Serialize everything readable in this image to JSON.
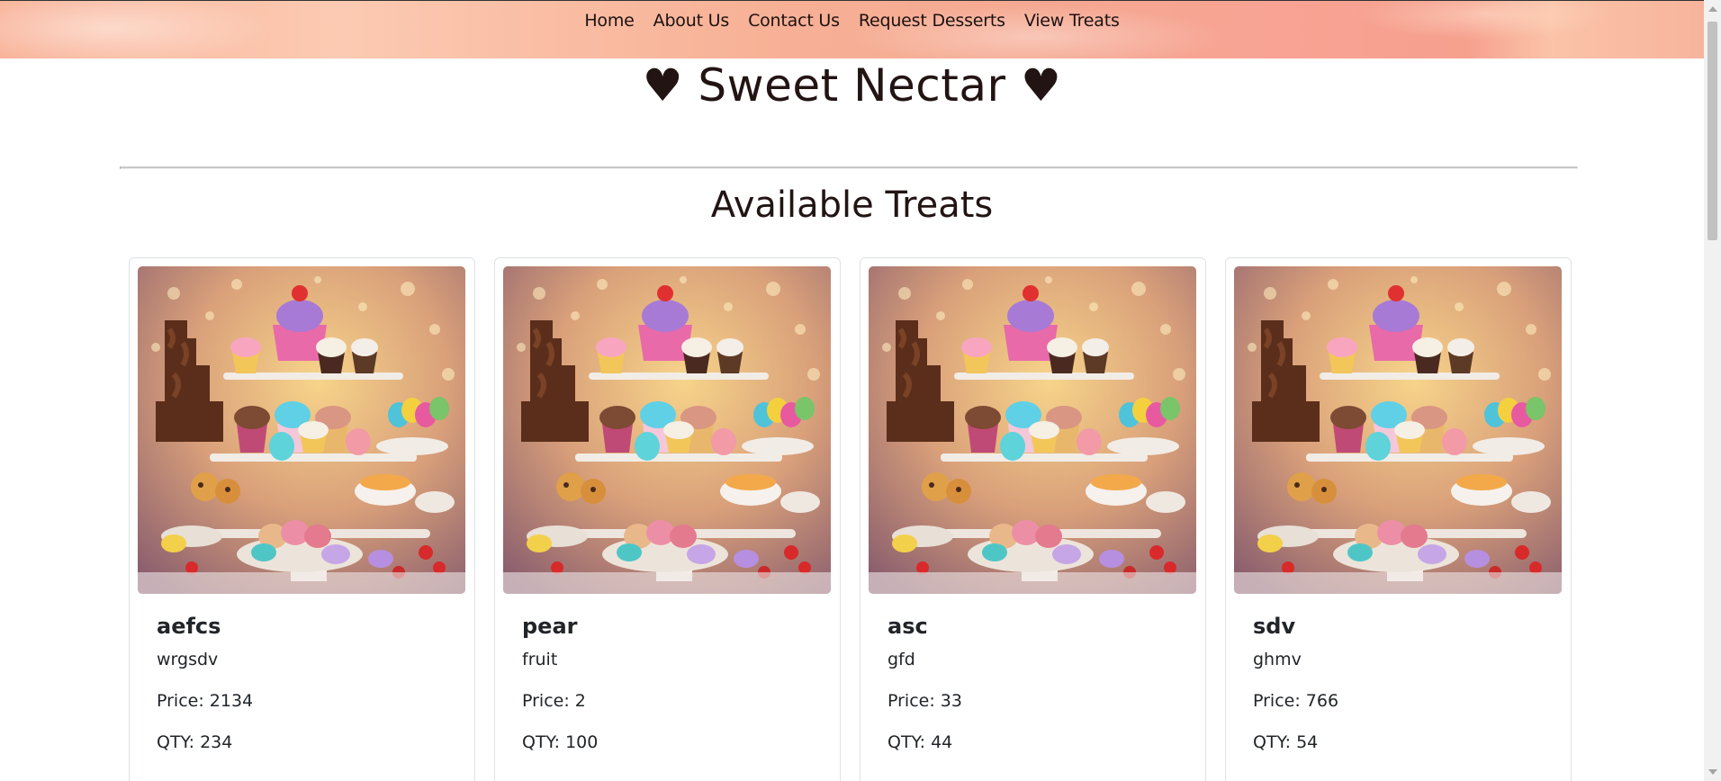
{
  "nav": {
    "links": [
      "Home",
      "About Us",
      "Contact Us",
      "Request Desserts",
      "View Treats"
    ]
  },
  "site_title": "♥ Sweet Nectar ♥",
  "section_title": "Available Treats",
  "price_label": "Price:",
  "qty_label": "QTY:",
  "treats": [
    {
      "name": "aefcs",
      "description": "wrgsdv",
      "price": "Price: 2134",
      "qty": "QTY: 234"
    },
    {
      "name": "pear",
      "description": "fruit",
      "price": "Price: 2",
      "qty": "QTY: 100"
    },
    {
      "name": "asc",
      "description": "gfd",
      "price": "Price: 33",
      "qty": "QTY: 44"
    },
    {
      "name": "sdv",
      "description": "ghmv",
      "price": "Price: 766",
      "qty": "QTY: 54"
    }
  ],
  "colors": {
    "nav_bg": "#f7b196",
    "title_text": "#231414",
    "card_border": "#dee2e6"
  },
  "icons": {
    "scroll_up": "triangle-up-icon",
    "scroll_down": "triangle-down-icon"
  }
}
